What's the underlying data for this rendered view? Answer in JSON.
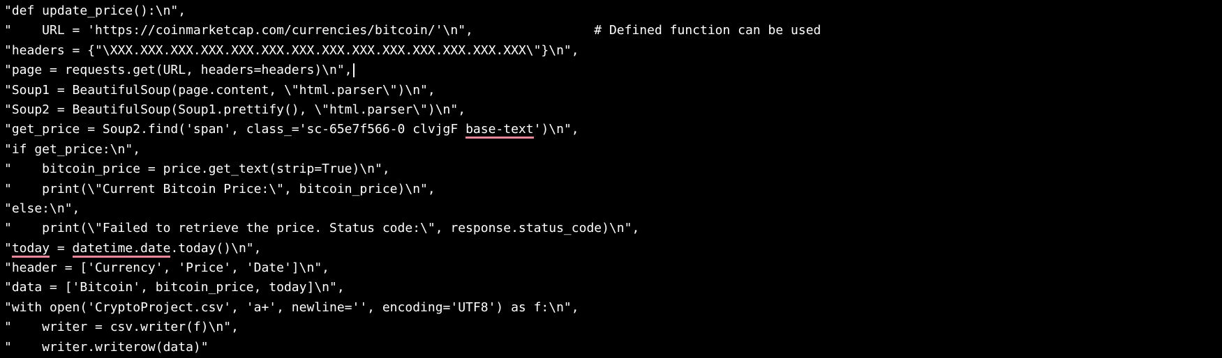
{
  "editor": {
    "lines": [
      [
        "\"def update_price():\\n\","
      ],
      [
        "\"    URL = 'https://coinmarketcap.com/currencies/bitcoin/'\\n\",                # Defined function can be used"
      ],
      [
        "\"headers = {\"\\XXX.XXX.XXX.XXX.XXX.XXX.XXX.XXX.XXX.XXX.XXX.XXX.XXX.XXX\\\"}\\n\","
      ],
      [
        "\"page = requests.get(URL, headers=headers)\\n\","
      ],
      [
        "\"Soup1 = BeautifulSoup(page.content, \\\"html.parser\\\")\\n\","
      ],
      [
        "\"Soup2 = BeautifulSoup(Soup1.prettify(), \\\"html.parser\\\")\\n\","
      ],
      [
        "\"get_price = Soup2.find('span', class_='sc-65e7f566-0 clvjgF ",
        "base-text",
        "')\\n\","
      ],
      [
        "\"if get_price:\\n\","
      ],
      [
        "\"    bitcoin_price = price.get_text(strip=True)\\n\","
      ],
      [
        "\"    print(\\\"Current Bitcoin Price:\\\", bitcoin_price)\\n\","
      ],
      [
        "\"else:\\n\","
      ],
      [
        "\"    print(\\\"Failed to retrieve the price. Status code:\\\", response.status_code)\\n\","
      ],
      [
        "\"",
        "today",
        " = ",
        "datetime.date",
        ".today()\\n\","
      ],
      [
        "\"header = ['Currency', 'Price', 'Date']\\n\","
      ],
      [
        "\"data = ['Bitcoin', bitcoin_price, today]\\n\","
      ],
      [
        "\"with open('CryptoProject.csv', 'a+', newline='', encoding='UTF8') as f:\\n\","
      ],
      [
        "\"    writer = csv.writer(f)\\n\","
      ],
      [
        "\"    writer.writerow(data)\""
      ]
    ],
    "squiggles": {
      "6": [
        1
      ],
      "12": [
        1,
        3
      ]
    },
    "caret_line": 3,
    "colors": {
      "background": "#000000",
      "text": "#ffffff",
      "squiggle": "#e8899a"
    }
  }
}
